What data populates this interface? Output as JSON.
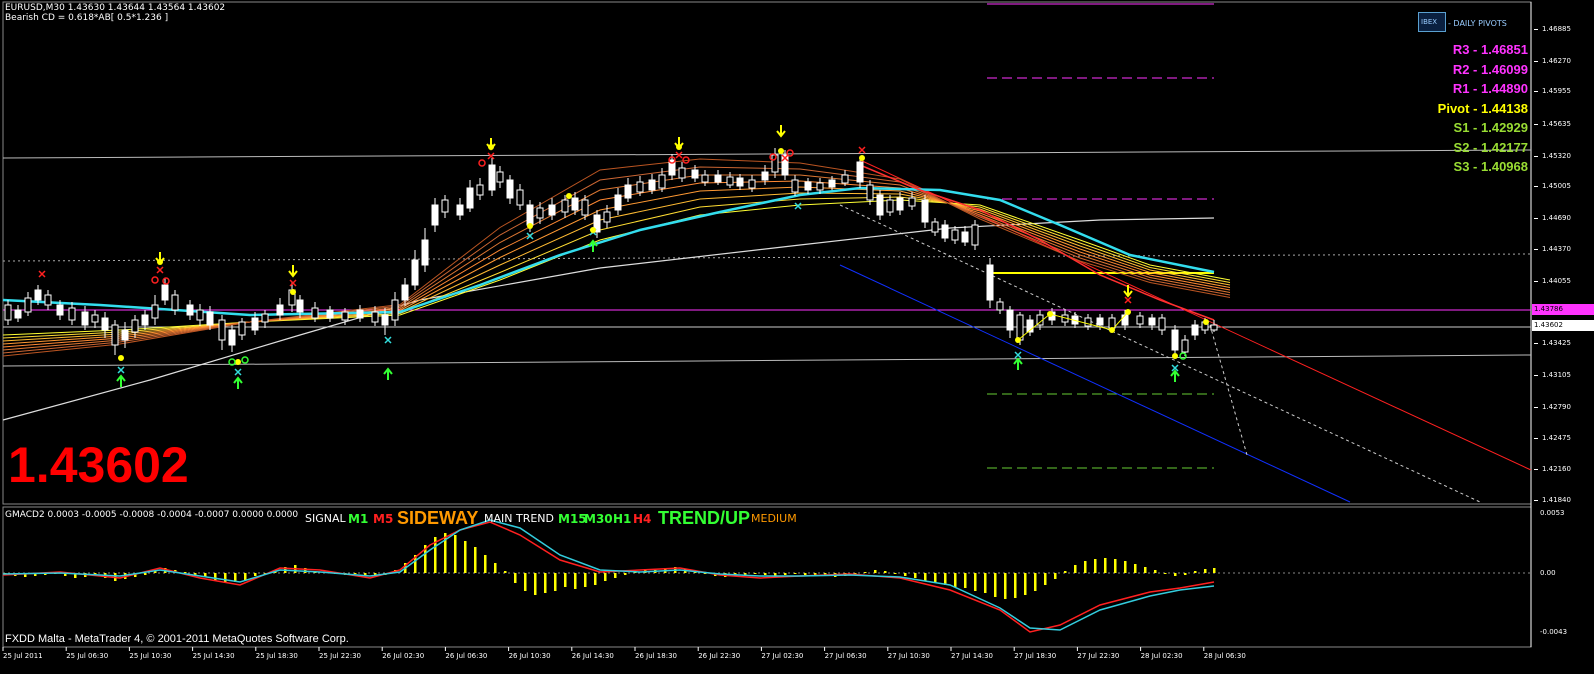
{
  "header": {
    "symbol_line": "EURUSD,M30  1.43630 1.43644 1.43564 1.43602",
    "pattern_line": "Bearish CD = 0.618*AB[ 0.5*1.236 ]"
  },
  "big_price": "1.43602",
  "logo": {
    "label": "- DAILY PIVOTS",
    "mark": "IBEX"
  },
  "pivots": [
    {
      "text": "R3 - 1.46851",
      "color": "#ff33ff"
    },
    {
      "text": "R2 - 1.46099",
      "color": "#ff33ff"
    },
    {
      "text": "R1 - 1.44890",
      "color": "#ff33ff"
    },
    {
      "text": "Pivot - 1.44138",
      "color": "#ffff00"
    },
    {
      "text": "S1 - 1.42929",
      "color": "#99dd33"
    },
    {
      "text": "S2 - 1.42177",
      "color": "#99dd33"
    },
    {
      "text": "S3 - 1.40968",
      "color": "#99dd33"
    }
  ],
  "price_axis": {
    "ticks": [
      "1.46885",
      "1.46270",
      "1.45955",
      "1.45635",
      "1.45320",
      "1.45005",
      "1.44690",
      "1.44370",
      "1.44055",
      "1.43425",
      "1.43105",
      "1.42790",
      "1.42475",
      "1.42160",
      "1.41840"
    ],
    "tag_magenta": "1.43786",
    "tag_current": "1.43602"
  },
  "indicator": {
    "header": "GMACD2 0.0003 -0.0005 -0.0008 -0.0004 -0.0007 0.0000 0.0000",
    "signal": "SIGNAL",
    "m1": "M1",
    "m5": "M5",
    "sideway": "SIDEWAY",
    "main_trend": "MAIN TREND",
    "m15": "M15",
    "m30": "M30",
    "h1": "H1",
    "h4": "H4",
    "trend_up": "TREND/UP",
    "medium": "MEDIUM",
    "axis": [
      "0.0053",
      "0.00",
      "-0.0043"
    ]
  },
  "footer": "FXDD Malta - MetaTrader 4, © 2001-2011 MetaQuotes Software Corp.",
  "time_axis": [
    "25 Jul 2011",
    "25 Jul 06:30",
    "25 Jul 10:30",
    "25 Jul 14:30",
    "25 Jul 18:30",
    "25 Jul 22:30",
    "26 Jul 02:30",
    "26 Jul 06:30",
    "26 Jul 10:30",
    "26 Jul 14:30",
    "26 Jul 18:30",
    "26 Jul 22:30",
    "27 Jul 02:30",
    "27 Jul 06:30",
    "27 Jul 10:30",
    "27 Jul 14:30",
    "27 Jul 18:30",
    "27 Jul 22:30",
    "28 Jul 02:30",
    "28 Jul 06:30"
  ],
  "colors": {
    "background": "#000000",
    "price_red": "#ff0000",
    "ma_cyan": "#33ccdd",
    "pivot_magenta": "#ff33ff",
    "trend_green": "#33ff33",
    "sideway_orange": "#ff9900"
  }
}
